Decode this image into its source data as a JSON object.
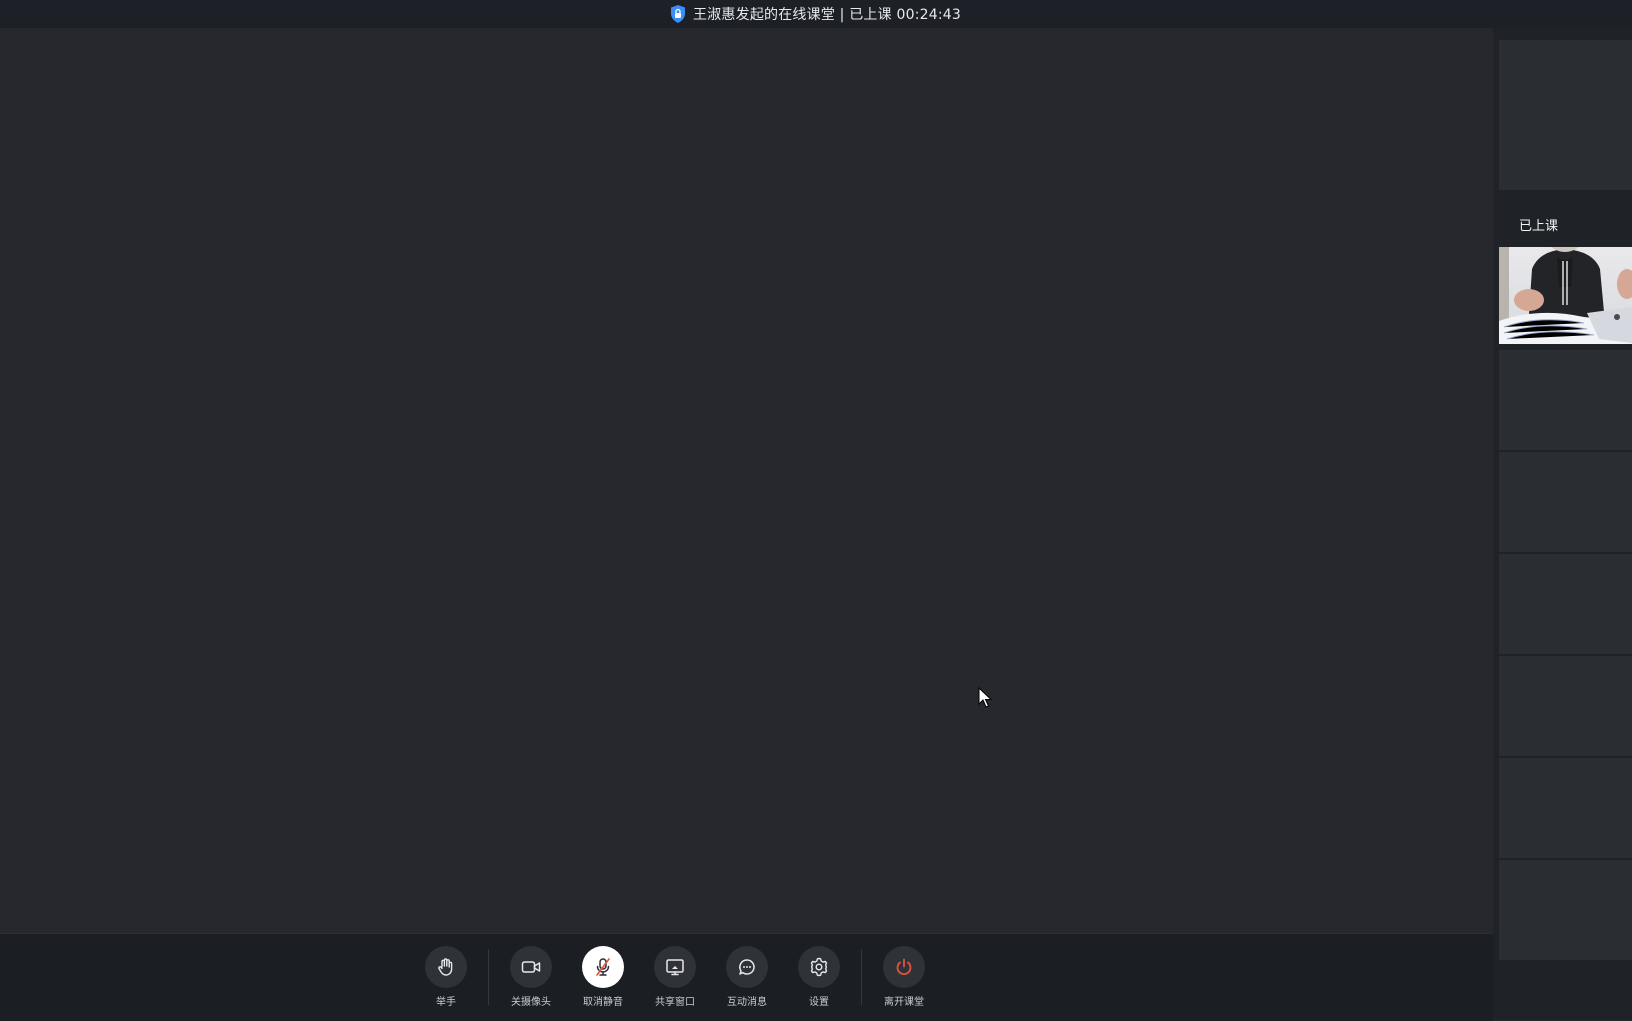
{
  "window": {
    "title": "王淑惠发起的在线课堂 | 已上课 00:24:43"
  },
  "icons": {
    "title": "shield-lock-icon",
    "raise_hand": "hand-icon",
    "camera": "video-camera-icon",
    "mic": "microphone-muted-icon",
    "share": "screen-share-icon",
    "messages": "chat-bubble-icon",
    "settings": "gear-icon",
    "leave": "power-icon",
    "cursor": "mouse-pointer-icon"
  },
  "colors": {
    "accent": "#3a8ef6",
    "leave": "#e5533d",
    "stage": "#26282d",
    "toolbar": "#1b1e23"
  },
  "toolbar": {
    "raise_hand_label": "举手",
    "camera_label": "关摄像头",
    "unmute_label": "取消静音",
    "share_label": "共享窗口",
    "messages_label": "互动消息",
    "settings_label": "设置",
    "leave_label": "离开课堂"
  },
  "sidebar": {
    "status_label": "已上课"
  }
}
